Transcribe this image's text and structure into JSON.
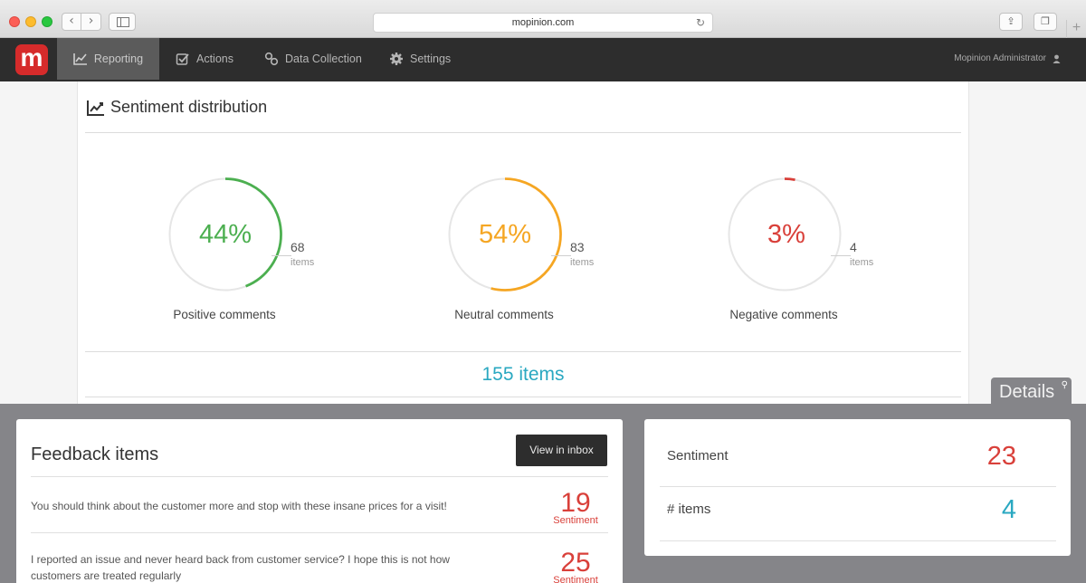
{
  "browser": {
    "url": "mopinion.com"
  },
  "app": {
    "logo_letter": "m",
    "nav": [
      {
        "label": "Reporting",
        "icon": "line-chart-icon"
      },
      {
        "label": "Actions",
        "icon": "checkbox-icon"
      },
      {
        "label": "Data Collection",
        "icon": "link-icon"
      },
      {
        "label": "Settings",
        "icon": "gear-icon"
      }
    ],
    "user": "Mopinion Administrator"
  },
  "sentiment": {
    "title": "Sentiment distribution",
    "items": [
      {
        "label": "Positive comments",
        "percent_text": "44%",
        "percent": 44,
        "count": "68",
        "unit": "items",
        "color": "#4caf50"
      },
      {
        "label": "Neutral comments",
        "percent_text": "54%",
        "percent": 54,
        "count": "83",
        "unit": "items",
        "color": "#f5a623"
      },
      {
        "label": "Negative comments",
        "percent_text": "3%",
        "percent": 3,
        "count": "4",
        "unit": "items",
        "color": "#d9403a"
      }
    ],
    "total": "155 items"
  },
  "details": {
    "tab_label": "Details",
    "feedback": {
      "title": "Feedback items",
      "button": "View in inbox",
      "rows": [
        {
          "text": "You should think about the customer more and stop with these insane prices for a visit!",
          "score": "19",
          "score_label": "Sentiment"
        },
        {
          "text": "I reported an issue and never heard back from customer service? I hope this is not how customers are treated regularly",
          "score": "25",
          "score_label": "Sentiment"
        }
      ]
    },
    "stats": [
      {
        "label": "Sentiment",
        "value": "23",
        "color": "#d9403a"
      },
      {
        "label": "# items",
        "value": "4",
        "color": "#2aa8c1"
      }
    ]
  },
  "colors": {
    "accent": "#2aa8c1",
    "negative": "#d9403a",
    "positive": "#4caf50",
    "neutral": "#f5a623",
    "nav_bg": "#2d2d2d",
    "logo": "#d62b2b"
  }
}
